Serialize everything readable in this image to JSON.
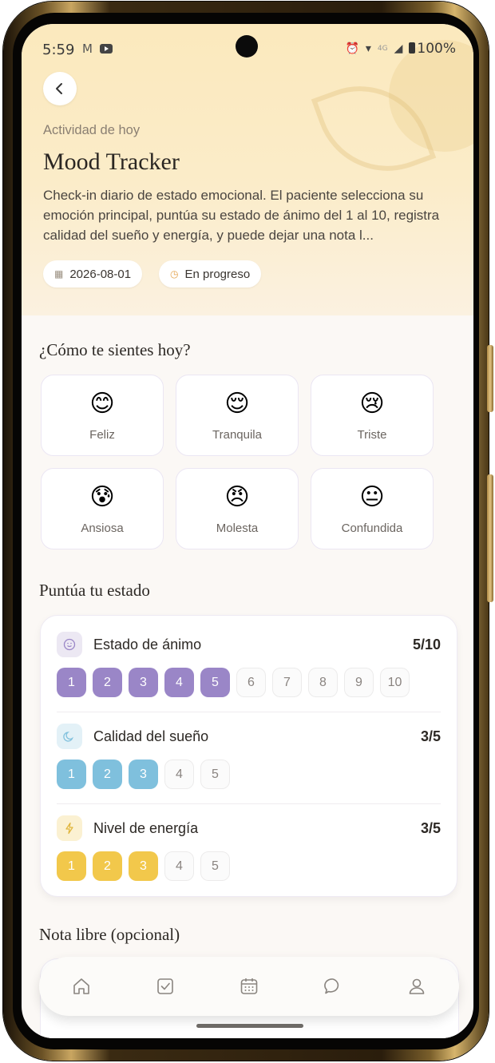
{
  "status_bar": {
    "time": "5:59",
    "left_icons": [
      "gmail-icon",
      "youtube-icon"
    ],
    "network": "4G",
    "battery": "100%"
  },
  "header": {
    "eyebrow": "Actividad de hoy",
    "title": "Mood Tracker",
    "description": "Check-in diario de estado emocional. El paciente selecciona su emoción principal, puntúa su estado de ánimo del 1 al 10, registra calidad del sueño y energía, y puede dejar una nota l...",
    "date": "2026-08-01",
    "status": "En progreso"
  },
  "mood_section": {
    "title": "¿Cómo te sientes hoy?",
    "moods": [
      {
        "emoji": "😊",
        "label": "Feliz"
      },
      {
        "emoji": "😌",
        "label": "Tranquila"
      },
      {
        "emoji": "😢",
        "label": "Triste"
      },
      {
        "emoji": "😰",
        "label": "Ansiosa"
      },
      {
        "emoji": "😠",
        "label": "Molesta"
      },
      {
        "emoji": "😐",
        "label": "Confundida"
      }
    ]
  },
  "rating_section": {
    "title": "Puntúa tu estado",
    "items": [
      {
        "icon": "smile-face-icon",
        "label": "Estado de ánimo",
        "value_text": "5/10",
        "value": 5,
        "max": 10,
        "accent": "#9a86c7",
        "icon_bg": "#ece8f3"
      },
      {
        "icon": "moon-icon",
        "label": "Calidad del sueño",
        "value_text": "3/5",
        "value": 3,
        "max": 5,
        "accent": "#7fc0dd",
        "icon_bg": "#e3f1f7"
      },
      {
        "icon": "lightning-icon",
        "label": "Nivel de energía",
        "value_text": "3/5",
        "value": 3,
        "max": 5,
        "accent": "#f2c84b",
        "icon_bg": "#fbf1d2"
      }
    ],
    "pills": {
      "mood": [
        "1",
        "2",
        "3",
        "4",
        "5",
        "6",
        "7",
        "8",
        "9",
        "10"
      ],
      "sleep": [
        "1",
        "2",
        "3",
        "4",
        "5"
      ],
      "energy": [
        "1",
        "2",
        "3",
        "4",
        "5"
      ]
    }
  },
  "note_section": {
    "title": "Nota libre (opcional)"
  },
  "tab_bar": {
    "tabs": [
      "home-icon",
      "checklist-icon",
      "calendar-icon",
      "chat-icon",
      "profile-icon"
    ]
  }
}
